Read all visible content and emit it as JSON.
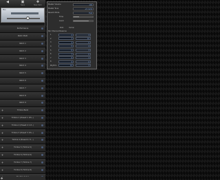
{
  "toolbar": {
    "buttons": [
      {
        "name": "back-button",
        "glyph": "◀",
        "label": ""
      },
      {
        "name": "save-button",
        "glyph": "▣",
        "label": "Save"
      },
      {
        "name": "new-item-button",
        "glyph": "✚",
        "label": "New Item"
      }
    ]
  },
  "device": {
    "label": "Mix"
  },
  "patches": [
    {
      "label": "Performance",
      "icon": ""
    },
    {
      "label": "Patch Multi",
      "icon": ""
    },
    {
      "label": "Patch 1",
      "icon": ""
    },
    {
      "label": "Patch 2",
      "icon": ""
    },
    {
      "label": "Patch 3",
      "icon": ""
    },
    {
      "label": "Patch 4",
      "icon": ""
    },
    {
      "label": "Patch 5",
      "icon": ""
    },
    {
      "label": "Patch 6",
      "icon": ""
    },
    {
      "label": "Patch 7",
      "icon": ""
    },
    {
      "label": "Patch 8",
      "icon": ""
    },
    {
      "label": "Patch 9",
      "icon": ""
    },
    {
      "label": "Timbre Bank",
      "icon": "+"
    },
    {
      "label": "Timbre 1 (Preset 1: RS...)",
      "icon": "+"
    },
    {
      "label": "Timbre 2 (Preset 2: Inf...)",
      "icon": "+"
    },
    {
      "label": "Timbre 3 (Preset 3: RS...)",
      "icon": "+"
    },
    {
      "label": "Timbre 4 (Preset 4: Ti...)",
      "icon": "+"
    },
    {
      "label": "Timbre 5 (Timbre 5)",
      "icon": "+"
    },
    {
      "label": "Timbre 6 (Timbre 6)",
      "icon": "+"
    },
    {
      "label": "Timbre 7 (Timbre 7)",
      "icon": "+"
    },
    {
      "label": "Timbre 8 (Timbre 8)",
      "icon": "+"
    },
    {
      "label": "Rhythm Setup",
      "icon": "+"
    }
  ],
  "editor": {
    "params": [
      {
        "label": "Master Volume",
        "value": "100"
      },
      {
        "label": "Master Tune",
        "value": "+0 cents"
      },
      {
        "label": "Reverb Mode",
        "value": "Hall"
      },
      {
        "label": "Time",
        "value": ""
      },
      {
        "label": "Level",
        "value": ""
      }
    ],
    "channel_headers": [
      "MIDI",
      "Partial"
    ],
    "per_channel_title": "Per Channel Reserve",
    "channels": [
      {
        "ch": "1",
        "midi": "2",
        "partial": "3"
      },
      {
        "ch": "2",
        "midi": "3",
        "partial": "10"
      },
      {
        "ch": "3",
        "midi": "4",
        "partial": "6"
      },
      {
        "ch": "4",
        "midi": "5",
        "partial": "4"
      },
      {
        "ch": "5",
        "midi": "6",
        "partial": "3"
      },
      {
        "ch": "6",
        "midi": "7",
        "partial": "0"
      },
      {
        "ch": "7",
        "midi": "8",
        "partial": "3"
      },
      {
        "ch": "8",
        "midi": "9",
        "partial": "0"
      },
      {
        "ch": "Rhythm",
        "midi": "10",
        "partial": "3"
      }
    ]
  },
  "bottom": {
    "icon": "settings-icon",
    "glyph": "✥"
  }
}
